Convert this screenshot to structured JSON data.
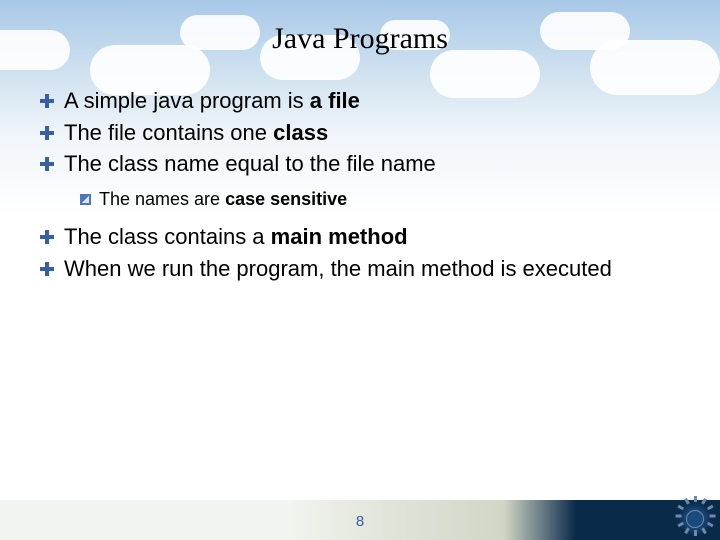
{
  "title": "Java Programs",
  "bullets": [
    {
      "pre": "A simple java program is ",
      "bold": "a file",
      "post": ""
    },
    {
      "pre": "The file contains one ",
      "bold": "class",
      "post": ""
    },
    {
      "pre": "The class name equal to the file name",
      "bold": "",
      "post": ""
    }
  ],
  "sub_bullets": [
    {
      "pre": "The names are ",
      "bold": "case sensitive",
      "post": ""
    }
  ],
  "bullets2": [
    {
      "pre": "The class contains a ",
      "bold": "main method",
      "post": ""
    },
    {
      "pre": "When we run the program, the main method is executed",
      "bold": "",
      "post": ""
    }
  ],
  "page_number": "8"
}
